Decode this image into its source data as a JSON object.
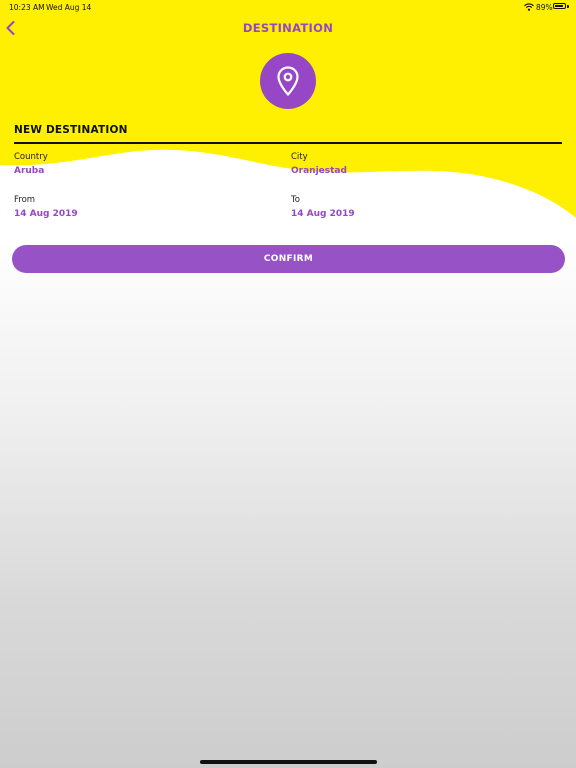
{
  "status_bar": {
    "time": "10:23 AM",
    "date": "Wed Aug 14",
    "battery_percent": "89%",
    "battery_level": 0.89,
    "wifi_icon": "wifi-icon"
  },
  "nav": {
    "back_icon": "chevron-left-icon",
    "title": "DESTINATION"
  },
  "header_icon": "map-pin-icon",
  "section": {
    "title": "NEW DESTINATION"
  },
  "fields": {
    "country": {
      "label": "Country",
      "value": "Aruba"
    },
    "city": {
      "label": "City",
      "value": "Oranjestad"
    },
    "from": {
      "label": "From",
      "value": "14 Aug 2019"
    },
    "to": {
      "label": "To",
      "value": "14 Aug 2019"
    }
  },
  "confirm_label": "CONFIRM",
  "colors": {
    "accent_yellow": "#FFEF00",
    "accent_purple": "#9747C6",
    "button_purple": "#9753C6"
  }
}
